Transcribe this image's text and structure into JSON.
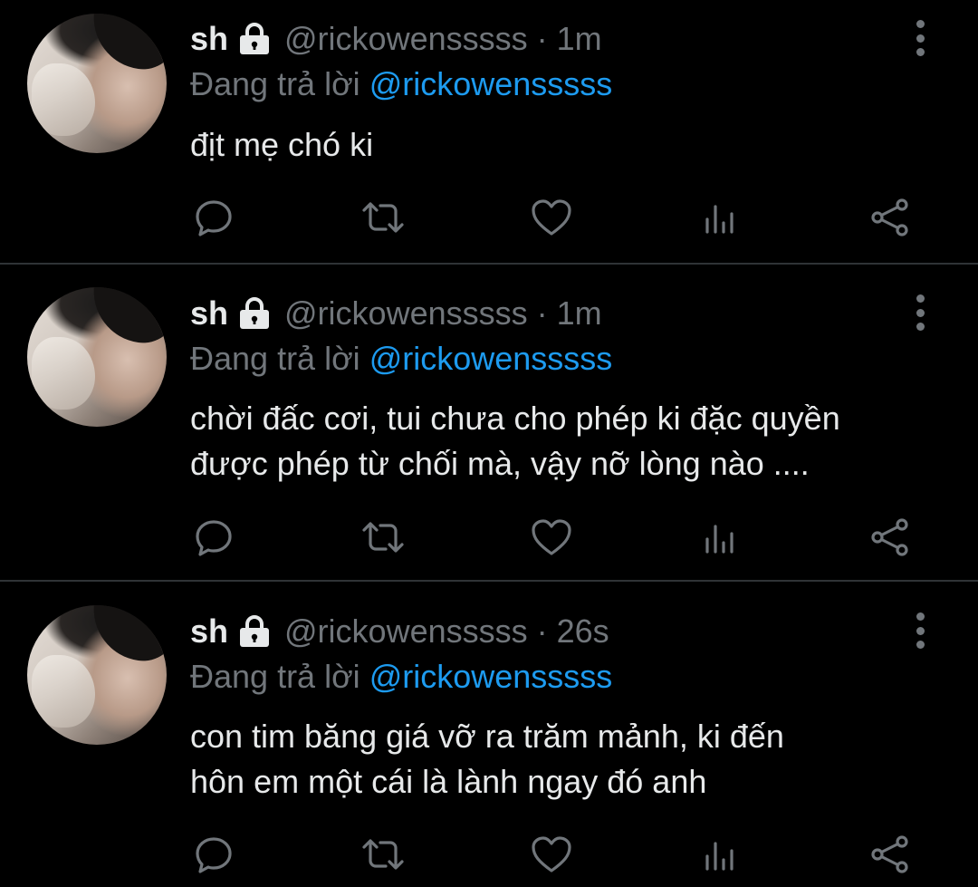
{
  "colors": {
    "background": "#000000",
    "text": "#E7E9EA",
    "secondary": "#71767B",
    "mention": "#1D9BF0",
    "divider": "#2F3336"
  },
  "tweets": [
    {
      "name": "sh",
      "handle": "@rickowensssss",
      "separator": "·",
      "time": "1m",
      "reply_prefix": "Đang trả lời",
      "reply_to": "@rickowensssss",
      "lines": [
        "địt mẹ chó ki"
      ]
    },
    {
      "name": "sh",
      "handle": "@rickowensssss",
      "separator": "·",
      "time": "1m",
      "reply_prefix": "Đang trả lời",
      "reply_to": "@rickowensssss",
      "lines": [
        "chời đấc cơi, tui chưa cho phép ki đặc quyền",
        "được phép từ chối mà, vậy nỡ lòng nào ...."
      ]
    },
    {
      "name": "sh",
      "handle": "@rickowensssss",
      "separator": "·",
      "time": "26s",
      "reply_prefix": "Đang trả lời",
      "reply_to": "@rickowensssss",
      "lines": [
        "con tim băng giá vỡ ra trăm mảnh, ki đến",
        "hôn em một cái là lành ngay đó anh"
      ]
    }
  ],
  "icons": {
    "protected": "lock-icon",
    "more": "more-vertical-icon",
    "reply": "reply-icon",
    "retweet": "retweet-icon",
    "like": "heart-icon",
    "views": "views-icon",
    "share": "share-icon"
  }
}
